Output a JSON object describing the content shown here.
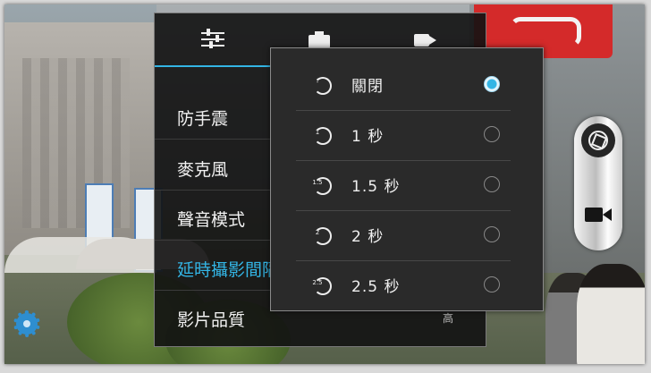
{
  "settings_panel": {
    "header_icons": [
      "sliders-icon",
      "camera-icon",
      "video-icon"
    ],
    "menu_items": [
      {
        "label": "防手震",
        "active": false
      },
      {
        "label": "麥克風",
        "active": false
      },
      {
        "label": "聲音模式",
        "active": false
      },
      {
        "label": "延時攝影間隔",
        "active": true
      },
      {
        "label": "影片品質",
        "active": false
      }
    ],
    "video_quality_value": "高"
  },
  "time_lapse_popup": {
    "options": [
      {
        "label": "關閉",
        "icon_text": "-",
        "selected": true
      },
      {
        "label": "1 秒",
        "icon_text": "1",
        "selected": false
      },
      {
        "label": "1.5 秒",
        "icon_text": "1.5",
        "selected": false
      },
      {
        "label": "2 秒",
        "icon_text": "2",
        "selected": false
      },
      {
        "label": "2.5 秒",
        "icon_text": "2.5",
        "selected": false
      }
    ]
  },
  "capture_controls": {
    "shutter_icon": "shutter-icon",
    "video_mode_icon": "video-camera-icon"
  },
  "corner_icon": "gear-icon",
  "accent_color": "#33b5e5"
}
